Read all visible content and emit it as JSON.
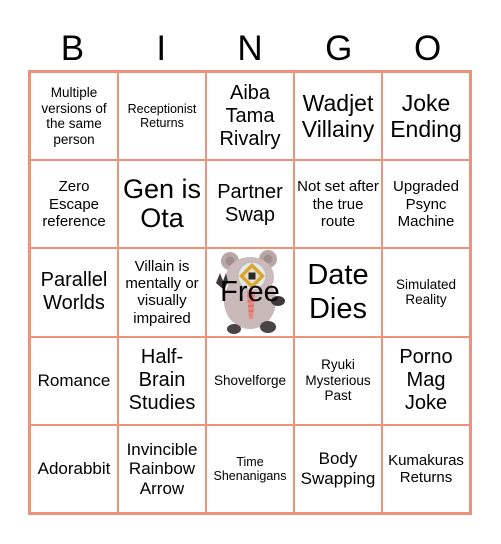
{
  "header": {
    "letters": [
      "B",
      "I",
      "N",
      "G",
      "O"
    ]
  },
  "colors": {
    "grid_border": "#ef927a",
    "text": "#000000",
    "background": "#ffffff"
  },
  "free_space": {
    "label": "Free",
    "icon": "mascot-bear-icon"
  },
  "cells": [
    [
      "Multiple versions of the same person",
      "Receptionist Returns",
      "Aiba Tama Rivalry",
      "Wadjet Villainy",
      "Joke Ending"
    ],
    [
      "Zero Escape reference",
      "Gen is Ota",
      "Partner Swap",
      "Not set after the true route",
      "Upgraded Psync Machine"
    ],
    [
      "Parallel Worlds",
      "Villain is mentally or visually impaired",
      "Free",
      "Date Dies",
      "Simulated Reality"
    ],
    [
      "Romance",
      "Half-Brain Studies",
      "Shovelforge",
      "Ryuki Mysterious Past",
      "Porno Mag Joke"
    ],
    [
      "Adorabbit",
      "Invincible Rainbow Arrow",
      "Time Shenanigans",
      "Body Swapping",
      "Kumakuras Returns"
    ]
  ]
}
